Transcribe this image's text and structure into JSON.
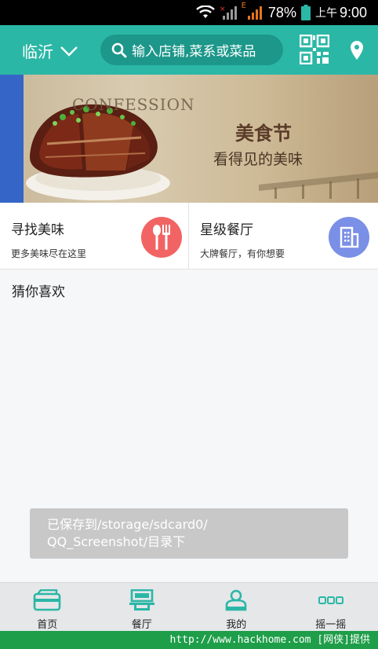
{
  "status_bar": {
    "battery_percent": "78%",
    "time_period": "上午",
    "time": "9:00",
    "network_label": "E",
    "icons": [
      "wifi-icon",
      "signal-icon",
      "signal-icon",
      "battery-icon"
    ]
  },
  "header": {
    "city": "临沂",
    "search_placeholder": "输入店铺,菜系或菜品",
    "icons": [
      "chevron-down-icon",
      "search-icon",
      "qr-code-icon",
      "location-pin-icon"
    ]
  },
  "banner": {
    "english_text": "CONFESSION",
    "title": "美食节",
    "subtitle": "看得见的美味"
  },
  "entries": [
    {
      "title": "寻找美味",
      "subtitle": "更多美味尽在这里",
      "icon": "fork-knife-icon",
      "color": "#f26464"
    },
    {
      "title": "星级餐厅",
      "subtitle": "大牌餐厅，有你想要",
      "icon": "building-icon",
      "color": "#7a8fe6"
    }
  ],
  "section": {
    "title": "猜你喜欢"
  },
  "toast": {
    "line1": "已保存到/storage/sdcard0/",
    "line2": "QQ_Screenshot/目录下"
  },
  "tabs": [
    {
      "label": "首页",
      "icon": "home-card-icon"
    },
    {
      "label": "餐厅",
      "icon": "restaurant-icon"
    },
    {
      "label": "我的",
      "icon": "user-icon"
    },
    {
      "label": "摇一摇",
      "icon": "shake-dots-icon"
    }
  ],
  "watermark": "http://www.hackhome.com [网侠]提供",
  "colors": {
    "accent": "#2bb7a6",
    "tab_icon": "#2bb7a6"
  }
}
